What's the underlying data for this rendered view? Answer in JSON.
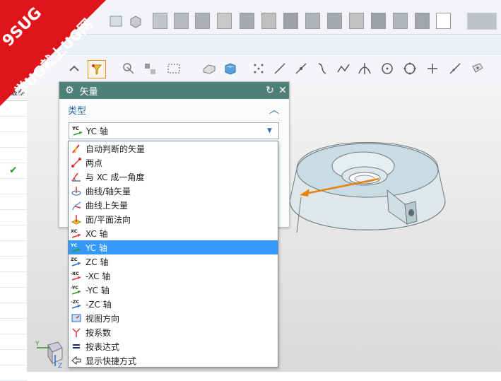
{
  "watermark": {
    "brand": "9SUG",
    "slogan": "学UG就上UG网"
  },
  "left_panel": {
    "header": "最新"
  },
  "dialog": {
    "title": "矢量",
    "section_type": "类型",
    "selected_type": "YC 轴",
    "selected_type_icon": "YC"
  },
  "dropdown": {
    "items": [
      {
        "label": "自动判断的矢量",
        "icon": "inferred-vector-icon"
      },
      {
        "label": "两点",
        "icon": "two-points-icon"
      },
      {
        "label": "与 XC 成一角度",
        "icon": "angle-to-xc-icon"
      },
      {
        "label": "曲线/轴矢量",
        "icon": "curve-axis-vector-icon"
      },
      {
        "label": "曲线上矢量",
        "icon": "vector-on-curve-icon"
      },
      {
        "label": "面/平面法向",
        "icon": "face-normal-icon"
      },
      {
        "label": "XC 轴",
        "icon": "xc-axis-icon",
        "tag": "XC"
      },
      {
        "label": "YC 轴",
        "icon": "yc-axis-icon",
        "tag": "YC",
        "selected": true
      },
      {
        "label": "ZC 轴",
        "icon": "zc-axis-icon",
        "tag": "ZC"
      },
      {
        "label": "-XC 轴",
        "icon": "neg-xc-axis-icon",
        "tag": "-XC"
      },
      {
        "label": "-YC 轴",
        "icon": "neg-yc-axis-icon",
        "tag": "-YC"
      },
      {
        "label": "-ZC 轴",
        "icon": "neg-zc-axis-icon",
        "tag": "-ZC"
      },
      {
        "label": "视图方向",
        "icon": "view-direction-icon"
      },
      {
        "label": "按系数",
        "icon": "by-coefficients-icon"
      },
      {
        "label": "按表达式",
        "icon": "by-expression-icon"
      },
      {
        "label": "显示快捷方式",
        "icon": "show-shortcuts-icon"
      }
    ]
  },
  "triad": {
    "y": "Y",
    "z": "Z"
  },
  "colors": {
    "dialog_title_bg": "#4e8078",
    "section_text": "#2d6ea5",
    "selection": "#3399ff",
    "watermark": "#e0141b",
    "model_surface": "#c9dbe3",
    "vector_arrow": "#e8820c"
  }
}
